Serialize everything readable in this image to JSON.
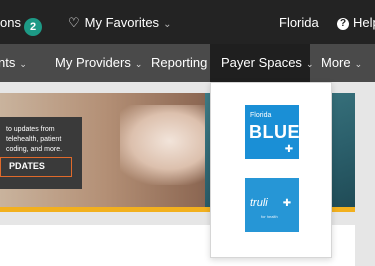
{
  "topbar": {
    "notifications_label": "ons",
    "notifications_count": "2",
    "favorites_label": "My Favorites",
    "state_label": "Florida",
    "help_label": "Help"
  },
  "nav": {
    "items": [
      {
        "label": "nts"
      },
      {
        "label": "My Providers"
      },
      {
        "label": "Reporting"
      },
      {
        "label": "Payer Spaces"
      },
      {
        "label": "More"
      }
    ]
  },
  "hero": {
    "promo_text": "to updates from\ntelehealth, patient\ncoding, and more.",
    "promo_button": "PDATES"
  },
  "payer_spaces": {
    "logos": [
      {
        "top_line": "Florida",
        "name": "BLUE",
        "icon": "blue-cross-shield-icon"
      },
      {
        "name": "truli",
        "tagline": "for health",
        "icon": "blue-cross-shield-icon"
      }
    ]
  },
  "colors": {
    "topbar_bg": "#232323",
    "nav_bg": "#4a4a4a",
    "nav_active_bg": "#1f1f1f",
    "badge": "#1d9a86",
    "accent_yellow": "#f2b01e",
    "promo_border": "#e06a2b",
    "florida_blue": "#1a8fd6",
    "truli_blue": "#2696d6"
  }
}
